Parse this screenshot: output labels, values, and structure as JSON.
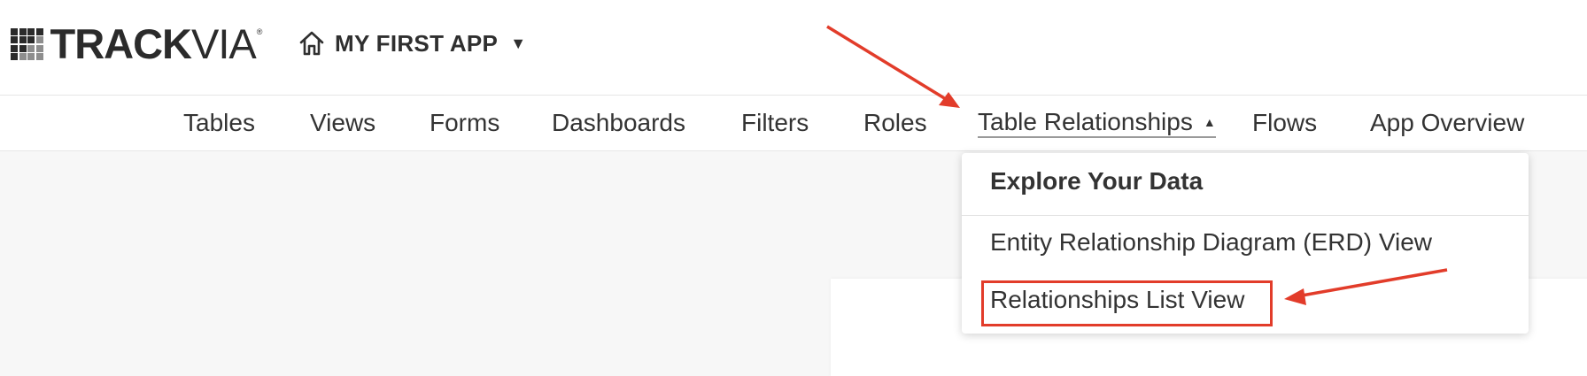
{
  "brand": {
    "logo_bold": "TRACK",
    "logo_light": "VIA",
    "registered": "®"
  },
  "app": {
    "name": "MY FIRST APP",
    "caret": "▼"
  },
  "nav": {
    "items": [
      {
        "label": "Tables"
      },
      {
        "label": "Views"
      },
      {
        "label": "Forms"
      },
      {
        "label": "Dashboards"
      },
      {
        "label": "Filters"
      },
      {
        "label": "Roles"
      },
      {
        "label": "Table Relationships",
        "caret": "▲"
      },
      {
        "label": "Flows"
      },
      {
        "label": "App Overview"
      }
    ]
  },
  "dropdown": {
    "header": "Explore Your Data",
    "items": [
      {
        "label": "Entity Relationship Diagram (ERD) View"
      },
      {
        "label": "Relationships List View"
      }
    ]
  },
  "colors": {
    "annotation": "#e23c2a",
    "background": "#f7f7f7",
    "text": "#333333"
  }
}
